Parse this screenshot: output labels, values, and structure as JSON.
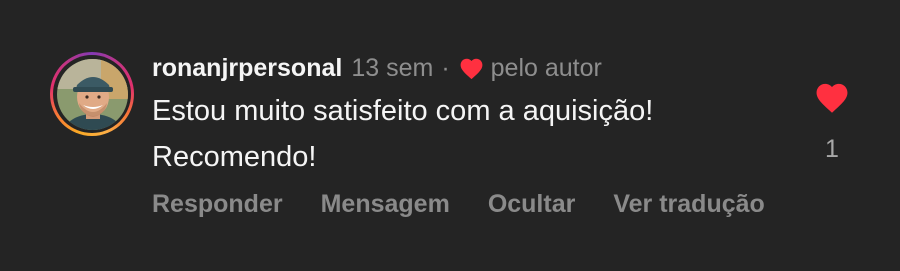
{
  "comment": {
    "username": "ronanjrpersonal",
    "time": "13 sem",
    "separator": "·",
    "liked_by": "pelo autor",
    "text": "Estou muito satisfeito com a aquisição! Recomendo!",
    "like_count": "1",
    "heart_color": "#ff3040",
    "icons": {
      "author_like": "heart-icon",
      "like_button": "heart-icon"
    }
  },
  "actions": {
    "reply": "Responder",
    "message": "Mensagem",
    "hide": "Ocultar",
    "translate": "Ver tradução"
  }
}
